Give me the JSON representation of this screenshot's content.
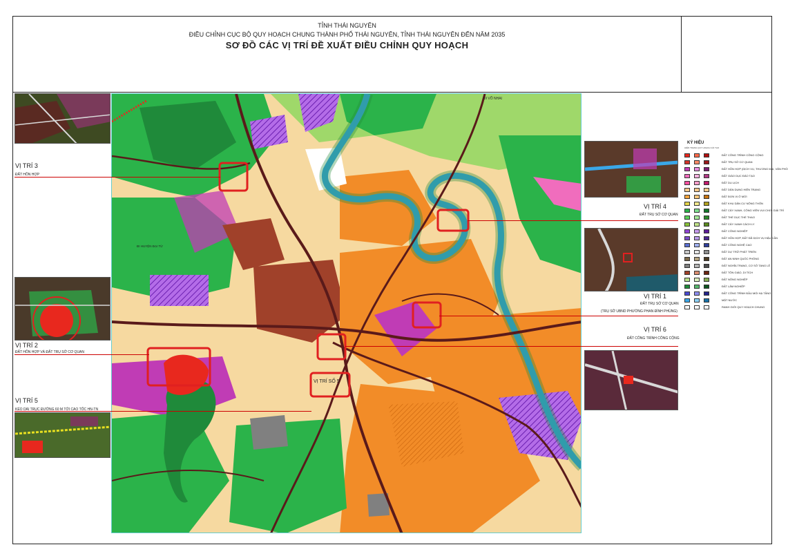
{
  "title": {
    "line1": "TỈNH THÁI NGUYÊN",
    "line2": "ĐIỀU CHỈNH CỤC BỘ QUY HOẠCH CHUNG THÀNH PHỐ THÁI NGUYÊN, TỈNH THÁI NGUYÊN ĐẾN NĂM 2035",
    "line3": "SƠ ĐỒ CÁC VỊ TRÍ ĐỀ XUẤT ĐIỀU CHỈNH QUY HOẠCH"
  },
  "positions": {
    "vt3": {
      "title": "VỊ TRÍ 3",
      "sub": "ĐẤT HỖN HỢP"
    },
    "vt2": {
      "title": "VỊ TRÍ 2",
      "sub": "ĐẤT HỖN HỢP VÀ ĐẤT TRỤ SỞ CƠ QUAN"
    },
    "vt5": {
      "title": "VỊ TRÍ 5",
      "sub": "KÉO DÀI TRỤC ĐƯỜNG 60 M TỚI CAO TỐC HN-TN"
    },
    "vt4": {
      "title": "VỊ TRÍ 4",
      "sub": "ĐẤT TRỤ SỞ CƠ QUAN"
    },
    "vt1": {
      "title": "VỊ TRÍ 1",
      "sub": "ĐẤT TRỤ SỞ CƠ QUAN",
      "sub2": "(TRỤ SỞ UBND PHƯỜNG PHAN ĐÌNH PHÙNG)"
    },
    "vt6": {
      "title": "VỊ TRÍ 6",
      "sub": "ĐẤT CÔNG TRÌNH CÔNG CỘNG"
    }
  },
  "map_labels": {
    "vtso5": "VỊ TRÍ SỐ 5",
    "di_vo_nhai": "ĐI VÕ NHAI",
    "di_huyen_dai_tu": "ĐI HUYỆN ĐẠI TỪ"
  },
  "legend": {
    "heading": "KÝ HIỆU",
    "subheading": "HIỆN TRẠNG  QUY HOẠCH  CẢI TẠO",
    "items": [
      {
        "label": "ĐẤT CÔNG TRÌNH CÔNG CỘNG",
        "colors": [
          "#e8281e",
          "#ff6a4a",
          "#b01010"
        ]
      },
      {
        "label": "ĐẤT TRỤ SỞ CƠ QUAN",
        "colors": [
          "#d2352a",
          "#ff8c69",
          "#9b1b1b"
        ]
      },
      {
        "label": "ĐẤT HỖN HỢP (DỊCH VỤ, THƯƠNG MẠI, VĂN PHÒNG...)",
        "colors": [
          "#c03cb5",
          "#e88ce0",
          "#7c1f72"
        ]
      },
      {
        "label": "ĐẤT GIÁO DỤC ĐÀO TẠO",
        "colors": [
          "#f06dbd",
          "#ffb3e0",
          "#b23c86"
        ]
      },
      {
        "label": "ĐẤT DU LỊCH",
        "colors": [
          "#ff4fa0",
          "#ff9ecb",
          "#c01a6c"
        ]
      },
      {
        "label": "ĐẤT DÂN DỤNG HIỆN TRẠNG",
        "colors": [
          "#f7c98a",
          "#f7c98a",
          "#f7c98a"
        ]
      },
      {
        "label": "ĐẤT ĐƠN VỊ Ở MỚI",
        "colors": [
          "#f3a33b",
          "#f8c77a",
          "#c87512"
        ]
      },
      {
        "label": "ĐẤT KHU DÂN CƯ NÔNG THÔN",
        "colors": [
          "#e3d44b",
          "#f2e98e",
          "#b0a020"
        ]
      },
      {
        "label": "ĐẤT CÂY XANH, CÔNG VIÊN VUI CHƠI GIẢI TRÍ",
        "colors": [
          "#2bb34a",
          "#7ee08e",
          "#15782c"
        ]
      },
      {
        "label": "ĐẤT THỂ DỤC THỂ THAO",
        "colors": [
          "#5ad15a",
          "#a6ec9a",
          "#2c8a2c"
        ]
      },
      {
        "label": "ĐẤT CÂY XANH CÁCH LY",
        "colors": [
          "#8ac43b",
          "#c2e48a",
          "#5a8a1f"
        ]
      },
      {
        "label": "ĐẤT CÔNG NGHIỆP",
        "colors": [
          "#9146d6",
          "#c79cf0",
          "#5d1f9a"
        ]
      },
      {
        "label": "ĐẤT HỖN HỢP, ĐẤT ĐÃ DỊCH VỤ HẬU CẦN",
        "colors": [
          "#7a4cc8",
          "#b89ae8",
          "#4a2890"
        ]
      },
      {
        "label": "ĐẤT CÔNG NGHỆ CAO",
        "colors": [
          "#5a6fd0",
          "#a0b0ef",
          "#2f3f9a"
        ]
      },
      {
        "label": "ĐẤT DỰ TRỮ PHÁT TRIỂN",
        "colors": [
          "#c8c8c8",
          "#e6e6e6",
          "#909090"
        ]
      },
      {
        "label": "ĐẤT AN NINH QUỐC PHÒNG",
        "colors": [
          "#7c6a4a",
          "#b3a27f",
          "#4a3a22"
        ]
      },
      {
        "label": "ĐẤT NGHĨA TRANG, CƠ SỞ TANG LỄ",
        "colors": [
          "#808080",
          "#b5b5b5",
          "#4f4f4f"
        ]
      },
      {
        "label": "ĐẤT TÔN GIÁO, DI TÍCH",
        "colors": [
          "#a0412a",
          "#d98e72",
          "#6a2512"
        ]
      },
      {
        "label": "ĐẤT NÔNG NGHIỆP",
        "colors": [
          "#b9e089",
          "#dcf0bf",
          "#84ad52"
        ]
      },
      {
        "label": "ĐẤT LÂM NGHIỆP",
        "colors": [
          "#1f8a3a",
          "#58b86e",
          "#0f5420"
        ]
      },
      {
        "label": "ĐẤT CÔNG TRÌNH ĐẦU MỐI HẠ TẦNG",
        "colors": [
          "#4a4ad0",
          "#8e8ef0",
          "#24248a"
        ]
      },
      {
        "label": "MẶT NƯỚC",
        "colors": [
          "#3aa7e8",
          "#8ad0f5",
          "#1872a8"
        ]
      },
      {
        "label": "RANH GIỚI QUY HOẠCH CHUNG",
        "colors": [
          "#ffffff",
          "#ffffff",
          "#ffffff"
        ]
      }
    ]
  },
  "colors": {
    "residential": "#f6d9a0",
    "new_residential": "#f28c28",
    "mixed": "#c03cb5",
    "green": "#2bb34a",
    "forest": "#1f8a3a",
    "industry": "#9146d6",
    "public": "#e8281e",
    "water": "#3aa7e8",
    "road": "#5a1a1a",
    "highlight": "#e02020"
  }
}
